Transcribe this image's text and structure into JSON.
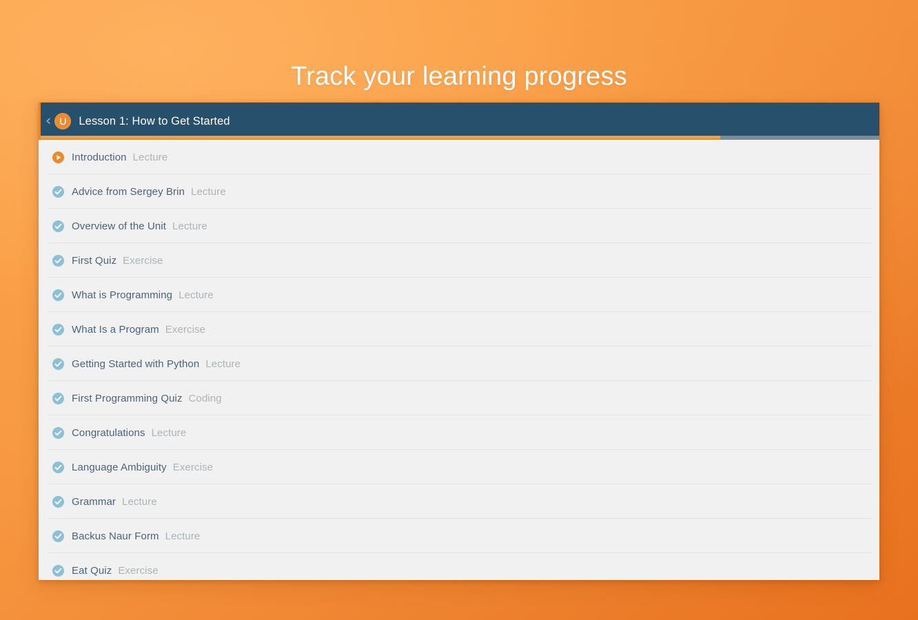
{
  "page": {
    "title": "Track your learning progress",
    "background_top": "#FAA24B",
    "background_bottom": "#E8711E"
  },
  "card": {
    "header": {
      "back_icon": "chevron-left-icon",
      "logo_letter": "U",
      "lesson_title": "Lesson 1: How to Get Started",
      "background_color": "#27506D",
      "accent_color": "#E9862C"
    },
    "progress": {
      "percent": 81,
      "fill_color": "#EFA14C",
      "track_color": "#7D8C98"
    },
    "lessons": [
      {
        "name": "Introduction",
        "type": "Lecture",
        "status": "current"
      },
      {
        "name": "Advice from Sergey Brin",
        "type": "Lecture",
        "status": "done"
      },
      {
        "name": "Overview of the Unit",
        "type": "Lecture",
        "status": "done"
      },
      {
        "name": "First Quiz",
        "type": "Exercise",
        "status": "done"
      },
      {
        "name": "What is Programming",
        "type": "Lecture",
        "status": "done"
      },
      {
        "name": "What Is a Program",
        "type": "Exercise",
        "status": "done"
      },
      {
        "name": "Getting Started with Python",
        "type": "Lecture",
        "status": "done"
      },
      {
        "name": "First Programming Quiz",
        "type": "Coding",
        "status": "done"
      },
      {
        "name": "Congratulations",
        "type": "Lecture",
        "status": "done"
      },
      {
        "name": "Language Ambiguity",
        "type": "Exercise",
        "status": "done"
      },
      {
        "name": "Grammar",
        "type": "Lecture",
        "status": "done"
      },
      {
        "name": "Backus Naur Form",
        "type": "Lecture",
        "status": "done"
      },
      {
        "name": "Eat Quiz",
        "type": "Exercise",
        "status": "done"
      }
    ]
  }
}
